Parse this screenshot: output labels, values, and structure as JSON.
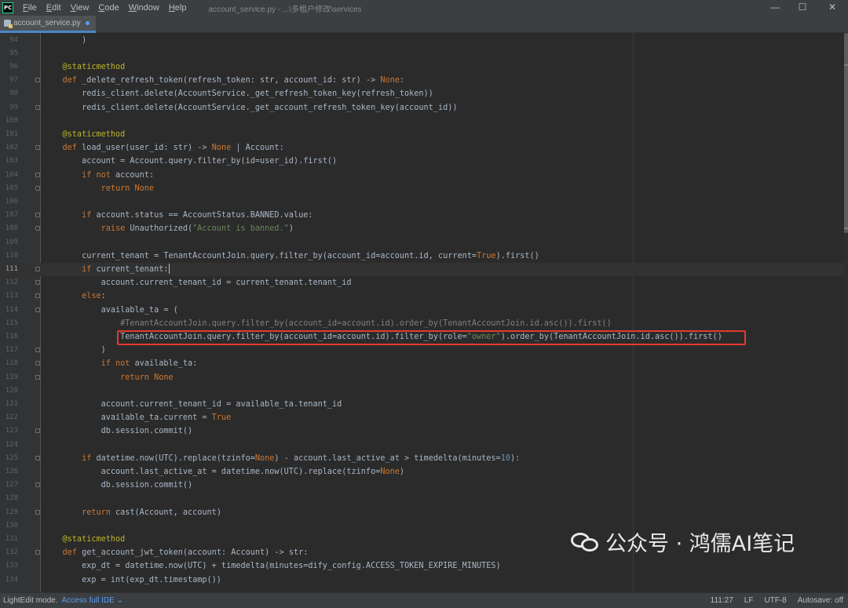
{
  "titlebar": {
    "logo_text": "PC",
    "menu": [
      {
        "mn": "F",
        "rest": "ile"
      },
      {
        "mn": "E",
        "rest": "dit"
      },
      {
        "mn": "V",
        "rest": "iew"
      },
      {
        "mn": "C",
        "rest": "ode"
      },
      {
        "mn": "W",
        "rest": "indow"
      },
      {
        "mn": "H",
        "rest": "elp"
      }
    ],
    "window_title": "account_service.py - ...\\多租户修改\\services",
    "minimize_glyph": "—",
    "maximize_glyph": "☐",
    "close_glyph": "✕"
  },
  "tab": {
    "filename": "account_service.py",
    "icon": "python-file-icon",
    "modified_dot_color": "#589df6"
  },
  "editor": {
    "current_line": 111,
    "highlighted_line": 116,
    "highlight_color": "#e33b2e",
    "lines": [
      {
        "n": "94",
        "code": [
          [
            "",
            "        )"
          ]
        ]
      },
      {
        "n": "95",
        "code": []
      },
      {
        "n": "96",
        "code": [
          [
            "dec",
            "    @staticmethod"
          ]
        ]
      },
      {
        "n": "97",
        "code": [
          [
            "kw",
            "    def "
          ],
          [
            "",
            "_delete_refresh_token(refresh_token: str, account_id: str) -> "
          ],
          [
            "kw",
            "None"
          ],
          [
            "",
            ":"
          ]
        ],
        "fold": true
      },
      {
        "n": "98",
        "code": [
          [
            "",
            "        redis_client.delete(AccountService._get_refresh_token_key(refresh_token))"
          ]
        ]
      },
      {
        "n": "99",
        "code": [
          [
            "",
            "        redis_client.delete(AccountService._get_account_refresh_token_key(account_id))"
          ]
        ],
        "fold": true
      },
      {
        "n": "100",
        "code": []
      },
      {
        "n": "101",
        "code": [
          [
            "dec",
            "    @staticmethod"
          ]
        ]
      },
      {
        "n": "102",
        "code": [
          [
            "kw",
            "    def "
          ],
          [
            "",
            "load_user(user_id: str) -> "
          ],
          [
            "kw",
            "None"
          ],
          [
            "",
            " | Account:"
          ]
        ],
        "fold": true
      },
      {
        "n": "103",
        "code": [
          [
            "",
            "        account = Account.query.filter_by(id=user_id).first()"
          ]
        ]
      },
      {
        "n": "104",
        "code": [
          [
            "kw",
            "        if not "
          ],
          [
            "",
            "account:"
          ]
        ],
        "fold": true
      },
      {
        "n": "105",
        "code": [
          [
            "kw",
            "            return None"
          ]
        ],
        "fold": true
      },
      {
        "n": "106",
        "code": []
      },
      {
        "n": "107",
        "code": [
          [
            "kw",
            "        if "
          ],
          [
            "",
            "account.status == AccountStatus.BANNED.value:"
          ]
        ],
        "fold": true
      },
      {
        "n": "108",
        "code": [
          [
            "kw",
            "            raise "
          ],
          [
            "",
            "Unauthorized("
          ],
          [
            "str",
            "\"Account is banned.\""
          ],
          [
            "",
            ")"
          ]
        ],
        "fold": true
      },
      {
        "n": "109",
        "code": []
      },
      {
        "n": "110",
        "code": [
          [
            "",
            "        current_tenant = TenantAccountJoin.query.filter_by(account_id=account.id, current="
          ],
          [
            "kw",
            "True"
          ],
          [
            "",
            ").first()"
          ]
        ]
      },
      {
        "n": "111",
        "code": [
          [
            "kw",
            "        if "
          ],
          [
            "",
            "current_tenant:"
          ]
        ],
        "fold": true,
        "caret": true
      },
      {
        "n": "112",
        "code": [
          [
            "",
            "            account.current_tenant_id = current_tenant.tenant_id"
          ]
        ],
        "fold": true
      },
      {
        "n": "113",
        "code": [
          [
            "kw",
            "        else"
          ],
          [
            "",
            ":"
          ]
        ],
        "fold": true
      },
      {
        "n": "114",
        "code": [
          [
            "",
            "            available_ta = ("
          ]
        ],
        "fold": true
      },
      {
        "n": "115",
        "code": [
          [
            "cmt",
            "                #TenantAccountJoin.query.filter_by(account_id=account.id).order_by(TenantAccountJoin.id.asc()).first()"
          ]
        ]
      },
      {
        "n": "116",
        "code": [
          [
            "",
            "                TenantAccountJoin.query.filter_by(account_id=account.id).filter_by(role="
          ],
          [
            "str",
            "\"owner\""
          ],
          [
            "",
            ").order_by(TenantAccountJoin.id.asc()).first()"
          ]
        ]
      },
      {
        "n": "117",
        "code": [
          [
            "",
            "            )"
          ]
        ],
        "fold": true
      },
      {
        "n": "118",
        "code": [
          [
            "kw",
            "            if not "
          ],
          [
            "",
            "available_ta:"
          ]
        ],
        "fold": true
      },
      {
        "n": "119",
        "code": [
          [
            "kw",
            "                return None"
          ]
        ],
        "fold": true
      },
      {
        "n": "120",
        "code": []
      },
      {
        "n": "121",
        "code": [
          [
            "",
            "            account.current_tenant_id = available_ta.tenant_id"
          ]
        ]
      },
      {
        "n": "122",
        "code": [
          [
            "",
            "            available_ta.current = "
          ],
          [
            "kw",
            "True"
          ]
        ]
      },
      {
        "n": "123",
        "code": [
          [
            "",
            "            db.session.commit()"
          ]
        ],
        "fold": true
      },
      {
        "n": "124",
        "code": []
      },
      {
        "n": "125",
        "code": [
          [
            "kw",
            "        if "
          ],
          [
            "",
            "datetime.now(UTC).replace(tzinfo="
          ],
          [
            "kw",
            "None"
          ],
          [
            "",
            ") - account.last_active_at > timedelta(minutes="
          ],
          [
            "num",
            "10"
          ],
          [
            "",
            "):"
          ]
        ],
        "fold": true
      },
      {
        "n": "126",
        "code": [
          [
            "",
            "            account.last_active_at = datetime.now(UTC).replace(tzinfo="
          ],
          [
            "kw",
            "None"
          ],
          [
            "",
            ")"
          ]
        ]
      },
      {
        "n": "127",
        "code": [
          [
            "",
            "            db.session.commit()"
          ]
        ],
        "fold": true
      },
      {
        "n": "128",
        "code": []
      },
      {
        "n": "129",
        "code": [
          [
            "kw",
            "        return "
          ],
          [
            "",
            "cast(Account, account)"
          ]
        ],
        "fold": true
      },
      {
        "n": "130",
        "code": []
      },
      {
        "n": "131",
        "code": [
          [
            "dec",
            "    @staticmethod"
          ]
        ]
      },
      {
        "n": "132",
        "code": [
          [
            "kw",
            "    def "
          ],
          [
            "",
            "get_account_jwt_token(account: Account) -> str:"
          ]
        ],
        "fold": true
      },
      {
        "n": "133",
        "code": [
          [
            "",
            "        exp_dt = datetime.now(UTC) + timedelta(minutes=dify_config.ACCESS_TOKEN_EXPIRE_MINUTES)"
          ]
        ]
      },
      {
        "n": "134",
        "code": [
          [
            "",
            "        exp = int(exp_dt.timestamp())"
          ]
        ]
      }
    ]
  },
  "watermark": {
    "icon": "wechat-icon",
    "text": "公众号 · 鸿儒AI笔记"
  },
  "statusbar": {
    "mode_text": "LightEdit mode.",
    "access_link": "Access full IDE",
    "access_chevron": "⌄",
    "position": "111:27",
    "line_separator": "LF",
    "encoding": "UTF-8",
    "autosave": "Autosave: off"
  }
}
